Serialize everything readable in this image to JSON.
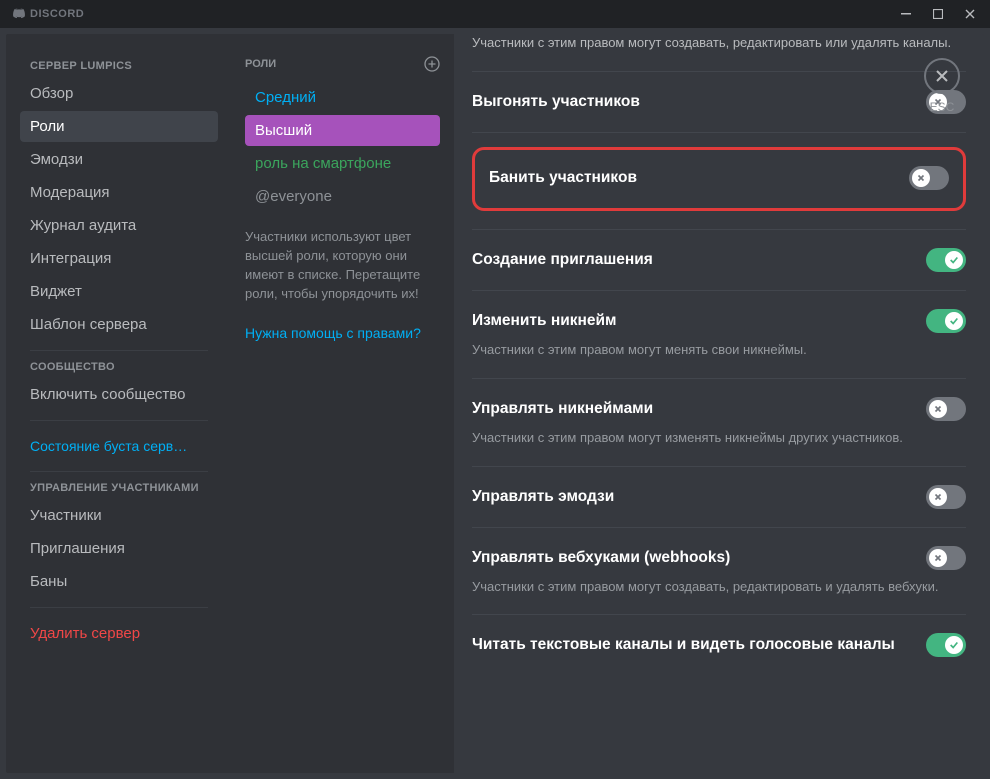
{
  "titlebar": {
    "app_name": "DISCORD",
    "esc_label": "ESC"
  },
  "sidebar": {
    "server_header": "СЕРВЕР LUMPICS",
    "items_main": [
      {
        "label": "Обзор",
        "id": "overview"
      },
      {
        "label": "Роли",
        "id": "roles",
        "active": true
      },
      {
        "label": "Эмодзи",
        "id": "emoji"
      },
      {
        "label": "Модерация",
        "id": "moderation"
      },
      {
        "label": "Журнал аудита",
        "id": "audit-log"
      },
      {
        "label": "Интеграция",
        "id": "integration"
      },
      {
        "label": "Виджет",
        "id": "widget"
      },
      {
        "label": "Шаблон сервера",
        "id": "template"
      }
    ],
    "community_header": "СООБЩЕСТВО",
    "community_items": [
      {
        "label": "Включить сообщество",
        "id": "enable-community"
      }
    ],
    "boost_link": "Состояние буста серв…",
    "members_header": "УПРАВЛЕНИЕ УЧАСТНИКАМИ",
    "members_items": [
      {
        "label": "Участники",
        "id": "members"
      },
      {
        "label": "Приглашения",
        "id": "invites"
      },
      {
        "label": "Баны",
        "id": "bans"
      }
    ],
    "delete_server": "Удалить сервер"
  },
  "roles": {
    "header": "РОЛИ",
    "list": [
      {
        "label": "Средний",
        "color": "#00aff4",
        "selected": false
      },
      {
        "label": "Высший",
        "color": "#ffffff",
        "selected": true
      },
      {
        "label": "роль на смартфоне",
        "color": "#3ba55d",
        "selected": false
      },
      {
        "label": "@everyone",
        "color": "#8e9297",
        "selected": false
      }
    ],
    "help_text": "Участники используют цвет высшей роли, которую они имеют в списке. Перетащите роли, чтобы упорядочить их!",
    "help_link": "Нужна помощь с правами?"
  },
  "permissions": {
    "intro": "Участники с этим правом могут создавать, редактировать или удалять каналы.",
    "items": [
      {
        "title": "Выгонять участников",
        "desc": "",
        "state": "off",
        "highlight": false
      },
      {
        "title": "Банить участников",
        "desc": "",
        "state": "off",
        "highlight": true
      },
      {
        "title": "Создание приглашения",
        "desc": "",
        "state": "on",
        "highlight": false
      },
      {
        "title": "Изменить никнейм",
        "desc": "Участники с этим правом могут менять свои никнеймы.",
        "state": "on",
        "highlight": false
      },
      {
        "title": "Управлять никнеймами",
        "desc": "Участники с этим правом могут изменять никнеймы других участников.",
        "state": "off",
        "highlight": false
      },
      {
        "title": "Управлять эмодзи",
        "desc": "",
        "state": "off",
        "highlight": false
      },
      {
        "title": "Управлять вебхуками (webhooks)",
        "desc": "Участники с этим правом могут создавать, редактировать и удалять вебхуки.",
        "state": "off",
        "highlight": false
      },
      {
        "title": "Читать текстовые каналы и видеть голосовые каналы",
        "desc": "",
        "state": "on",
        "highlight": false
      }
    ]
  }
}
